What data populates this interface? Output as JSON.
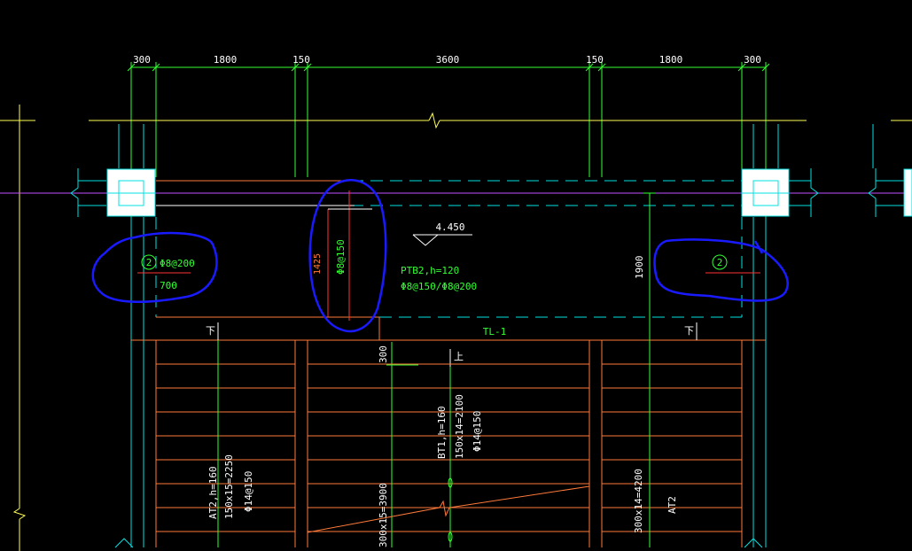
{
  "dimensions": {
    "top": [
      "300",
      "1800",
      "150",
      "3600",
      "150",
      "1800",
      "300"
    ],
    "side_1900": "1900",
    "side_1425": "1425",
    "side_300": "300"
  },
  "annotations": {
    "elevation": "4.450",
    "slab_label": "PTB2,h=120",
    "slab_rebar": "Φ8@150/Φ8@200",
    "left_rebar_marker": "2",
    "left_rebar_spec": "Φ8@200",
    "left_rebar_length": "700",
    "right_rebar_marker": "2",
    "mid_rebar_spec": "Φ8@150",
    "beam_label": "TL-1",
    "down_left": "下",
    "down_right": "下",
    "up_mid": "上"
  },
  "stairs": {
    "left_name": "AT2,h=160",
    "left_steps": "150x15=2250",
    "left_rebar": "Φ14@150",
    "left_run": "300x15=3900",
    "mid_name": "BT1,h=160",
    "mid_steps": "150x14=2100",
    "mid_rebar": "Φ14@150",
    "right_run": "300x14=4200",
    "right_name": "AT2"
  },
  "colors": {
    "background": "#000000",
    "dimension_green": "#33ff33",
    "axis_cyan": "#00e0e0",
    "stair_orange": "#ff7a3a",
    "markup_blue": "#1a1aff",
    "reference_yellow": "#ffff55"
  }
}
